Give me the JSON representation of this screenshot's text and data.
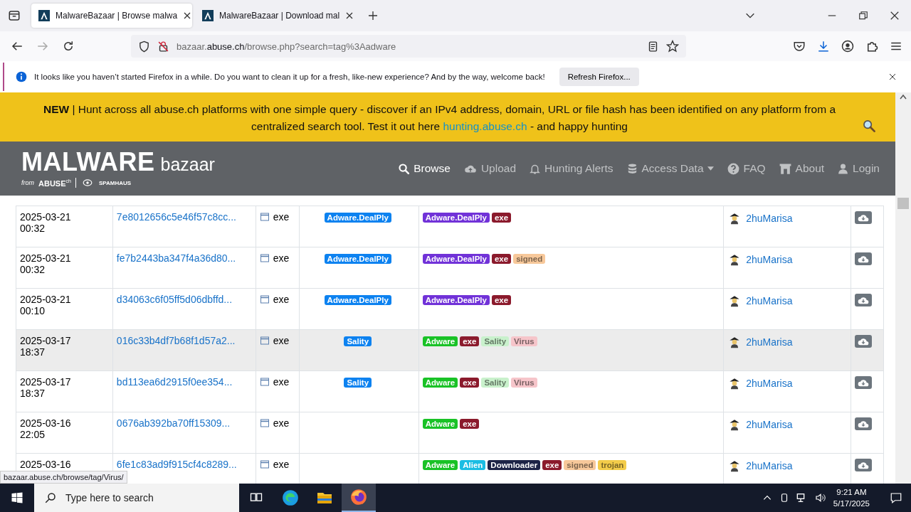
{
  "browser": {
    "tabs": [
      {
        "title": "MalwareBazaar | Browse malwa",
        "selected": true
      },
      {
        "title": "MalwareBazaar | Download mal",
        "selected": false
      }
    ],
    "url": {
      "host_pre": "bazaar.",
      "host": "abuse.ch",
      "path": "/browse.php?search=tag%3Aadware"
    },
    "notification": {
      "text": "It looks like you haven’t started Firefox in a while. Do you want to clean it up for a fresh, like-new experience? And by the way, welcome back!",
      "button": "Refresh Firefox..."
    }
  },
  "banner": {
    "lead": "**NEW** | Hunt across all abuse.ch platforms with one simple query - discover if an IPv4 address, domain, URL or file hash has been identified on any platform from a centralized search tool. Test it out here",
    "link": "hunting.abuse.ch",
    "tail": "- and happy hunting"
  },
  "header": {
    "logo_main": "MALWARE",
    "logo_sub": "bazaar",
    "logo_from": "from",
    "logo_abuse": "ABUSE",
    "logo_ch": "ch",
    "logo_spamhaus": "SPAMHAUS",
    "nav": [
      {
        "label": "Browse",
        "selected": true
      },
      {
        "label": "Upload",
        "selected": false
      },
      {
        "label": "Hunting Alerts",
        "selected": false
      },
      {
        "label": "Access Data",
        "selected": false
      },
      {
        "label": "FAQ",
        "selected": false
      },
      {
        "label": "About",
        "selected": false
      },
      {
        "label": "Login",
        "selected": false
      }
    ]
  },
  "table": {
    "rows": [
      {
        "date": "2025-03-21",
        "time": "00:32",
        "hash": "7e8012656c5e46f57c8cc...",
        "type": "exe",
        "signature": "Adware.DealPly",
        "tags": [
          {
            "text": "Adware.DealPly",
            "color": "#7132d8"
          },
          {
            "text": "exe",
            "color": "#8b1a2c"
          }
        ],
        "reporter": "2huMarisa",
        "hovered": false
      },
      {
        "date": "2025-03-21",
        "time": "00:32",
        "hash": "fe7b2443ba347f4a36d80...",
        "type": "exe",
        "signature": "Adware.DealPly",
        "tags": [
          {
            "text": "Adware.DealPly",
            "color": "#7132d8"
          },
          {
            "text": "exe",
            "color": "#8b1a2c"
          },
          {
            "text": "signed",
            "color": "#f7c89a"
          }
        ],
        "reporter": "2huMarisa",
        "hovered": false
      },
      {
        "date": "2025-03-21",
        "time": "00:10",
        "hash": "d34063c6f05ff5d06dbffd...",
        "type": "exe",
        "signature": "Adware.DealPly",
        "tags": [
          {
            "text": "Adware.DealPly",
            "color": "#7132d8"
          },
          {
            "text": "exe",
            "color": "#8b1a2c"
          }
        ],
        "reporter": "2huMarisa",
        "hovered": false
      },
      {
        "date": "2025-03-17",
        "time": "18:37",
        "hash": "016c33b4df7b68f1d57a2...",
        "type": "exe",
        "signature": "Sality",
        "tags": [
          {
            "text": "Adware",
            "color": "#19c226"
          },
          {
            "text": "exe",
            "color": "#8b1a2c"
          },
          {
            "text": "Sality",
            "color": "#c9f1cc"
          },
          {
            "text": "Virus",
            "color": "#f6c5ca"
          }
        ],
        "reporter": "2huMarisa",
        "hovered": true
      },
      {
        "date": "2025-03-17",
        "time": "18:37",
        "hash": "bd113ea6d2915f0ee354...",
        "type": "exe",
        "signature": "Sality",
        "tags": [
          {
            "text": "Adware",
            "color": "#19c226"
          },
          {
            "text": "exe",
            "color": "#8b1a2c"
          },
          {
            "text": "Sality",
            "color": "#c9f1cc"
          },
          {
            "text": "Virus",
            "color": "#f6c5ca"
          }
        ],
        "reporter": "2huMarisa",
        "hovered": false
      },
      {
        "date": "2025-03-16",
        "time": "22:05",
        "hash": "0676ab392ba70ff15309...",
        "type": "exe",
        "tags": [
          {
            "text": "Adware",
            "color": "#19c226"
          },
          {
            "text": "exe",
            "color": "#8b1a2c"
          }
        ],
        "reporter": "2huMarisa",
        "hovered": false
      },
      {
        "date": "2025-03-16",
        "hash": "6fe1c83ad9f915cf4c8289...",
        "type": "exe",
        "tags": [
          {
            "text": "Adware",
            "color": "#19c226"
          },
          {
            "text": "Alien",
            "color": "#1bbde3"
          },
          {
            "text": "Downloader",
            "color": "#1d2447"
          },
          {
            "text": "exe",
            "color": "#8b1a2c"
          },
          {
            "text": "signed",
            "color": "#f7c89a"
          },
          {
            "text": "trojan",
            "color": "#f3cc4a"
          }
        ],
        "reporter": "2huMarisa",
        "hovered": false
      }
    ]
  },
  "status_link": "bazaar.abuse.ch/browse/tag/Virus/",
  "taskbar": {
    "search_placeholder": "Type here to search",
    "apps": [
      {
        "selected": false
      },
      {
        "selected": false
      },
      {
        "selected": false
      },
      {
        "selected": true
      }
    ],
    "time": "9:21 AM",
    "date": "5/17/2025"
  }
}
